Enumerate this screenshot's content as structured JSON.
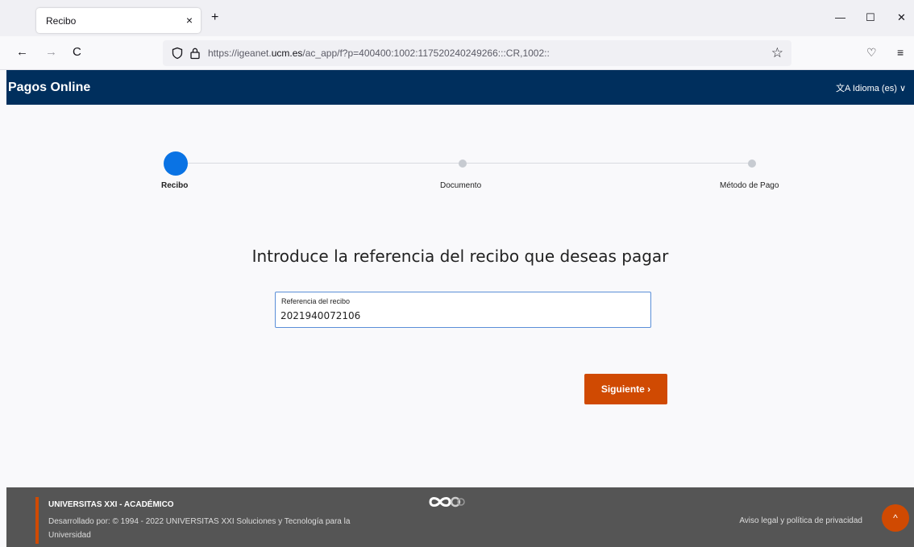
{
  "browser": {
    "tab_title": "Recibo",
    "tab_close": "×",
    "new_tab": "+",
    "minimize": "—",
    "maximize": "☐",
    "close": "✕",
    "back": "←",
    "forward": "→",
    "reload": "C",
    "url_prefix": "https://igeanet.",
    "url_host": "ucm.es",
    "url_suffix": "/ac_app/f?p=400400:1002:117520240249266:::CR,1002::",
    "bookmark_star": "☆",
    "pocket": "♡",
    "menu": "≡"
  },
  "app": {
    "title": "Pagos Online",
    "language": "Idioma (es)",
    "language_icon": "文A",
    "language_caret": "∨"
  },
  "steps": [
    {
      "label": "Recibo",
      "active": true
    },
    {
      "label": "Documento",
      "active": false
    },
    {
      "label": "Método de Pago",
      "active": false
    }
  ],
  "form": {
    "heading": "Introduce la referencia del recibo que deseas pagar",
    "field_label": "Referencia del recibo",
    "field_value": "2021940072106",
    "next_label": "Siguiente ›"
  },
  "footer": {
    "org": "UNIVERSITAS XXI - ACADÉMICO",
    "credit": "Desarrollado por: © 1994 - 2022  UNIVERSITAS XXI Soluciones y Tecnología para la Universidad",
    "legal": "Aviso legal y política de privacidad",
    "scroll_top": "^"
  },
  "colors": {
    "header": "#002f5d",
    "accent": "#d04a02",
    "step_active": "#0a73e4",
    "footer": "#555555"
  }
}
